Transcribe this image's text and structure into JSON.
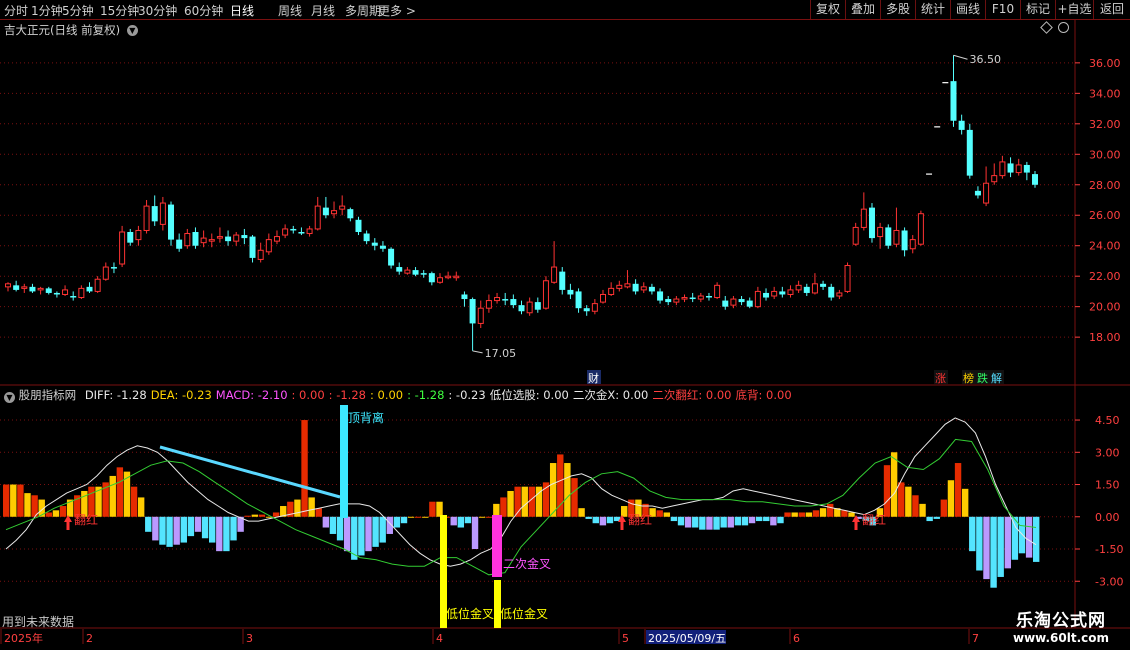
{
  "toolbar": {
    "periods": [
      "分时",
      "1分钟",
      "5分钟",
      "15分钟",
      "30分钟",
      "60分钟",
      "日线",
      "周线",
      "月线",
      "多周期",
      "更多 >"
    ],
    "active_period": "日线",
    "right_buttons": [
      "复权",
      "叠加",
      "多股",
      "统计",
      "画线",
      "F10",
      "标记",
      "+自选",
      "返回"
    ]
  },
  "price_panel": {
    "title": "吉大正元(日线 前复权)",
    "high_label": "36.50",
    "low_label": "17.05",
    "cai_label": "财",
    "tags": [
      {
        "text": "涨",
        "color": "#ff3333"
      },
      {
        "text": "榜",
        "color": "#ffd200"
      },
      {
        "text": "跌",
        "color": "#33ff66"
      },
      {
        "text": "解",
        "color": "#55ddff"
      }
    ],
    "y_ticks": [
      "36.00",
      "34.00",
      "32.00",
      "30.00",
      "28.00",
      "26.00",
      "24.00",
      "22.00",
      "20.00",
      "18.00"
    ]
  },
  "indicator_panel": {
    "title": "股朋指标网",
    "values": [
      {
        "text": "DIFF: -1.28",
        "color": "#e8e8e8"
      },
      {
        "text": "DEA: -0.23",
        "color": "#ffd200"
      },
      {
        "text": "MACD: -2.10",
        "color": "#ff55ff"
      },
      {
        "text": ": 0.00",
        "color": "#ff4040"
      },
      {
        "text": ": -1.28",
        "color": "#ff4040"
      },
      {
        "text": ": 0.00",
        "color": "#ffd200"
      },
      {
        "text": ": -1.28",
        "color": "#40ff40"
      },
      {
        "text": ": -0.23",
        "color": "#e8e8e8"
      },
      {
        "text": "低位选股: 0.00",
        "color": "#e8e8e8"
      },
      {
        "text": "二次金X: 0.00",
        "color": "#e8e8e8"
      },
      {
        "text": "二次翻红: 0.00",
        "color": "#ff4040"
      },
      {
        "text": "底背: 0.00",
        "color": "#ff4040"
      }
    ],
    "y_ticks": [
      "4.50",
      "3.00",
      "1.50",
      "0.00",
      "-1.50",
      "-3.00"
    ],
    "annotations": {
      "top_divergence": "顶背离",
      "low_gold_1": "低位金叉",
      "low_gold_2": "低位金叉",
      "second_gold": "二次金叉",
      "flip_red": "翻红"
    },
    "footer_note": "用到未来数据"
  },
  "date_axis": {
    "labels": [
      "2025年",
      "2",
      "3",
      "4",
      "5",
      "2025/05/09/五",
      "6",
      "7"
    ]
  },
  "watermark": {
    "name": "乐淘公式网",
    "url": "www.60lt.com"
  },
  "colors": {
    "up": "#ff3333",
    "down": "#54ffff",
    "grid": "#7a1010",
    "axis_text": "#ff4040",
    "bar_red": "#e62b00",
    "bar_yellow": "#ffcc00",
    "bar_cyan": "#54e5ff",
    "bar_violet": "#bb99ff"
  },
  "chart_data": [
    {
      "type": "candlestick",
      "title": "吉大正元(日线 前复权)",
      "ylim": [
        16.5,
        37.5
      ],
      "candles": [
        [
          21.3,
          21.5,
          21.6,
          21.0
        ],
        [
          21.4,
          21.1,
          21.7,
          21.0
        ],
        [
          21.2,
          21.3,
          21.5,
          20.9
        ],
        [
          21.3,
          21.0,
          21.5,
          20.9
        ],
        [
          21.1,
          21.2,
          21.3,
          20.8
        ],
        [
          21.2,
          20.9,
          21.3,
          20.8
        ],
        [
          20.9,
          20.8,
          21.0,
          20.6
        ],
        [
          20.8,
          21.1,
          21.4,
          20.7
        ],
        [
          20.7,
          20.6,
          21.0,
          20.4
        ],
        [
          20.6,
          21.2,
          21.4,
          20.5
        ],
        [
          21.3,
          21.0,
          21.6,
          20.9
        ],
        [
          21.0,
          21.8,
          22.0,
          20.9
        ],
        [
          21.8,
          22.6,
          22.9,
          21.7
        ],
        [
          22.6,
          22.5,
          22.9,
          22.2
        ],
        [
          22.8,
          24.9,
          25.3,
          22.6
        ],
        [
          24.9,
          24.2,
          25.1,
          24.0
        ],
        [
          24.4,
          25.0,
          25.3,
          24.0
        ],
        [
          25.0,
          26.6,
          27.0,
          24.8
        ],
        [
          26.6,
          25.6,
          27.3,
          25.3
        ],
        [
          25.4,
          26.8,
          27.2,
          25.0
        ],
        [
          26.7,
          24.4,
          26.9,
          24.0
        ],
        [
          24.4,
          23.8,
          24.8,
          23.6
        ],
        [
          24.0,
          24.8,
          25.1,
          23.8
        ],
        [
          24.9,
          24.0,
          25.2,
          23.8
        ],
        [
          24.2,
          24.5,
          25.0,
          23.9
        ],
        [
          24.3,
          24.4,
          24.8,
          23.9
        ],
        [
          24.5,
          24.6,
          25.2,
          24.2
        ],
        [
          24.6,
          24.3,
          25.0,
          24.0
        ],
        [
          24.3,
          24.7,
          24.9,
          24.0
        ],
        [
          24.7,
          24.5,
          25.1,
          24.1
        ],
        [
          24.6,
          23.2,
          24.7,
          22.9
        ],
        [
          23.1,
          23.7,
          24.2,
          22.9
        ],
        [
          23.6,
          24.4,
          24.8,
          23.4
        ],
        [
          24.3,
          24.6,
          25.0,
          24.1
        ],
        [
          24.7,
          25.1,
          25.4,
          24.5
        ],
        [
          25.1,
          25.0,
          25.3,
          24.8
        ],
        [
          24.9,
          24.8,
          25.2,
          24.7
        ],
        [
          24.8,
          25.1,
          25.3,
          24.6
        ],
        [
          25.1,
          26.6,
          27.2,
          25.0
        ],
        [
          26.5,
          26.0,
          27.2,
          25.8
        ],
        [
          26.1,
          26.3,
          26.9,
          25.8
        ],
        [
          26.4,
          26.6,
          27.3,
          26.0
        ],
        [
          26.4,
          25.8,
          26.5,
          25.6
        ],
        [
          25.7,
          24.9,
          25.9,
          24.7
        ],
        [
          24.8,
          24.3,
          25.0,
          24.1
        ],
        [
          24.2,
          24.0,
          24.5,
          23.7
        ],
        [
          24.0,
          23.8,
          24.3,
          23.6
        ],
        [
          23.8,
          22.7,
          23.9,
          22.5
        ],
        [
          22.6,
          22.3,
          22.9,
          22.1
        ],
        [
          22.2,
          22.4,
          22.6,
          22.1
        ],
        [
          22.4,
          22.1,
          22.6,
          22.0
        ],
        [
          22.2,
          22.1,
          22.4,
          21.9
        ],
        [
          22.2,
          21.6,
          22.3,
          21.4
        ],
        [
          21.6,
          21.9,
          22.2,
          21.5
        ],
        [
          21.9,
          22.0,
          22.3,
          21.8
        ],
        [
          21.9,
          22.0,
          22.3,
          21.7
        ],
        [
          20.8,
          20.5,
          21.0,
          20.0
        ],
        [
          20.5,
          18.9,
          20.6,
          17.1
        ],
        [
          18.9,
          19.9,
          20.4,
          18.6
        ],
        [
          19.9,
          20.4,
          20.8,
          19.6
        ],
        [
          20.4,
          20.6,
          20.9,
          20.2
        ],
        [
          20.5,
          20.4,
          20.9,
          20.1
        ],
        [
          20.5,
          20.1,
          20.8,
          19.9
        ],
        [
          20.1,
          19.7,
          20.4,
          19.5
        ],
        [
          19.6,
          20.3,
          20.6,
          19.4
        ],
        [
          20.3,
          19.8,
          20.6,
          19.6
        ],
        [
          19.9,
          21.7,
          22.0,
          19.8
        ],
        [
          21.6,
          22.6,
          24.3,
          21.5
        ],
        [
          22.3,
          21.1,
          22.6,
          20.8
        ],
        [
          21.1,
          20.8,
          21.5,
          20.5
        ],
        [
          21.0,
          19.9,
          21.2,
          19.6
        ],
        [
          19.9,
          19.7,
          20.1,
          19.4
        ],
        [
          19.7,
          20.2,
          20.5,
          19.5
        ],
        [
          20.3,
          20.8,
          21.1,
          20.2
        ],
        [
          20.8,
          21.2,
          21.6,
          20.7
        ],
        [
          21.2,
          21.4,
          21.7,
          21.0
        ],
        [
          21.3,
          21.5,
          22.4,
          21.2
        ],
        [
          21.5,
          21.0,
          21.8,
          20.8
        ],
        [
          21.1,
          21.3,
          21.6,
          20.9
        ],
        [
          21.3,
          21.0,
          21.5,
          20.8
        ],
        [
          21.0,
          20.4,
          21.2,
          20.2
        ],
        [
          20.5,
          20.3,
          20.7,
          20.1
        ],
        [
          20.3,
          20.5,
          20.7,
          20.1
        ],
        [
          20.5,
          20.6,
          20.8,
          20.3
        ],
        [
          20.6,
          20.5,
          20.9,
          20.3
        ],
        [
          20.5,
          20.7,
          20.9,
          20.3
        ],
        [
          20.7,
          20.6,
          20.9,
          20.4
        ],
        [
          20.6,
          21.4,
          21.6,
          20.5
        ],
        [
          20.4,
          20.0,
          20.7,
          19.8
        ],
        [
          20.1,
          20.5,
          20.7,
          19.9
        ],
        [
          20.5,
          20.3,
          20.7,
          20.1
        ],
        [
          20.4,
          20.0,
          20.6,
          19.9
        ],
        [
          20.0,
          21.0,
          21.3,
          19.9
        ],
        [
          20.9,
          20.6,
          21.2,
          20.4
        ],
        [
          20.7,
          21.0,
          21.3,
          20.5
        ],
        [
          21.0,
          20.8,
          21.3,
          20.6
        ],
        [
          20.8,
          21.1,
          21.4,
          20.6
        ],
        [
          21.1,
          21.4,
          21.7,
          20.9
        ],
        [
          21.3,
          20.9,
          21.5,
          20.7
        ],
        [
          20.9,
          21.5,
          22.2,
          20.8
        ],
        [
          21.5,
          21.3,
          21.7,
          21.1
        ],
        [
          21.3,
          20.6,
          21.5,
          20.4
        ],
        [
          20.7,
          20.9,
          21.1,
          20.5
        ],
        [
          21.0,
          22.7,
          22.9,
          20.9
        ],
        [
          24.1,
          25.2,
          25.5,
          24.0
        ],
        [
          25.2,
          26.4,
          27.5,
          25.0
        ],
        [
          26.5,
          24.5,
          26.8,
          24.2
        ],
        [
          24.6,
          25.2,
          25.5,
          23.8
        ],
        [
          25.2,
          24.0,
          25.4,
          23.8
        ],
        [
          24.1,
          25.0,
          26.5,
          23.9
        ],
        [
          25.0,
          23.7,
          25.2,
          23.3
        ],
        [
          23.8,
          24.4,
          24.7,
          23.5
        ],
        [
          24.1,
          26.1,
          26.3,
          24.0
        ],
        [
          28.7,
          28.7,
          28.7,
          28.7
        ],
        [
          31.8,
          31.8,
          31.8,
          31.8
        ],
        [
          34.7,
          34.7,
          34.7,
          34.7
        ],
        [
          34.8,
          32.2,
          36.5,
          31.8
        ],
        [
          32.2,
          31.6,
          32.6,
          31.3
        ],
        [
          31.6,
          28.6,
          32.0,
          28.4
        ],
        [
          27.6,
          27.3,
          27.9,
          27.1
        ],
        [
          26.8,
          28.1,
          29.2,
          26.6
        ],
        [
          28.2,
          28.6,
          29.4,
          28.0
        ],
        [
          28.6,
          29.5,
          29.9,
          28.4
        ],
        [
          29.4,
          28.8,
          29.8,
          28.5
        ],
        [
          28.8,
          29.3,
          29.7,
          28.6
        ],
        [
          29.3,
          28.8,
          29.5,
          28.3
        ],
        [
          28.7,
          28.0,
          28.9,
          27.8
        ]
      ]
    },
    {
      "type": "bar",
      "title": "股朋指标网",
      "ylim": [
        -3.5,
        5.2
      ],
      "values": [
        1.5,
        1.5,
        1.5,
        1.1,
        1.0,
        0.8,
        0.2,
        0.3,
        0.5,
        0.8,
        1.0,
        1.2,
        1.4,
        1.4,
        1.6,
        1.9,
        2.3,
        2.1,
        1.4,
        0.9,
        -0.7,
        -1.1,
        -1.3,
        -1.4,
        -1.3,
        -1.2,
        -0.9,
        -0.7,
        -1.0,
        -1.2,
        -1.6,
        -1.6,
        -1.1,
        -0.7,
        0.05,
        0.1,
        0.1,
        0.0,
        0.2,
        0.5,
        0.7,
        0.8,
        4.5,
        0.9,
        0.4,
        -0.5,
        -0.8,
        -1.1,
        -1.6,
        -2.0,
        -1.8,
        -1.6,
        -1.4,
        -1.2,
        -0.8,
        -0.5,
        -0.3,
        0.0,
        0.0,
        0.0,
        0.7,
        0.7,
        0.0,
        -0.4,
        -0.5,
        -0.3,
        -1.5,
        0.0,
        0.0,
        0.6,
        0.9,
        1.2,
        1.4,
        1.4,
        1.4,
        1.4,
        1.6,
        2.5,
        2.9,
        2.5,
        1.8,
        0.4,
        -0.1,
        -0.3,
        -0.4,
        -0.3,
        -0.2,
        0.5,
        0.8,
        0.8,
        0.6,
        0.4,
        0.3,
        0.2,
        -0.2,
        -0.4,
        -0.5,
        -0.5,
        -0.6,
        -0.6,
        -0.6,
        -0.5,
        -0.5,
        -0.4,
        -0.4,
        -0.3,
        -0.2,
        -0.2,
        -0.4,
        -0.3,
        0.2,
        0.2,
        0.2,
        0.2,
        0.3,
        0.4,
        0.6,
        0.4,
        0.3,
        0.2,
        -0.1,
        -0.2,
        -0.4,
        0.4,
        2.4,
        3.0,
        1.6,
        1.4,
        1.0,
        0.6,
        -0.2,
        -0.1,
        0.8,
        1.7,
        2.5,
        1.3,
        -1.6,
        -2.5,
        -2.9,
        -3.3,
        -2.8,
        -2.4,
        -2.0,
        -1.7,
        -1.9,
        -2.1
      ],
      "diff": [
        -1.5,
        -1.1,
        -0.6,
        0.1,
        0.5,
        0.8,
        1.1,
        1.3,
        1.5,
        1.9,
        2.4,
        2.8,
        3.1,
        3.3,
        3.2,
        3.0,
        2.6,
        2.1,
        1.6,
        1.2,
        0.8,
        0.5,
        0.2,
        0.0,
        -0.2,
        -0.2,
        -0.1,
        0.0,
        0.1,
        0.2,
        0.3,
        0.4,
        0.5,
        0.6,
        0.6,
        0.6,
        0.5,
        0.2,
        -0.3,
        -0.8,
        -1.3,
        -1.7,
        -2.0,
        -2.2,
        -2.3,
        -2.2,
        -2.0,
        -1.7,
        -1.5,
        -1.0,
        -0.2,
        0.4,
        0.8,
        1.2,
        1.5,
        1.7,
        1.9,
        2.0,
        1.8,
        1.3,
        1.0,
        0.8,
        0.6,
        0.5,
        0.5,
        0.4,
        0.5,
        0.6,
        0.7,
        0.8,
        0.8,
        0.9,
        1.2,
        1.3,
        1.2,
        1.1,
        1.0,
        0.9,
        0.8,
        0.7,
        0.6,
        0.5,
        0.4,
        0.3,
        0.2,
        0.1,
        0.3,
        0.6,
        1.1,
        2.0,
        2.8,
        3.3,
        3.8,
        4.3,
        4.6,
        4.4,
        3.9,
        2.8,
        1.5,
        0.5,
        -0.5,
        -1.0,
        -1.3
      ],
      "dea": [
        -0.6,
        -0.3,
        0.0,
        0.4,
        0.7,
        1.0,
        1.3,
        1.6,
        2.0,
        2.4,
        2.6,
        2.5,
        2.1,
        1.6,
        1.1,
        0.6,
        0.2,
        -0.2,
        -0.6,
        -0.9,
        -1.2,
        -1.5,
        -1.9,
        -2.0,
        -2.2,
        -2.3,
        -2.3,
        -1.9,
        -1.9,
        -2.3,
        -2.7,
        -2.6,
        -1.4,
        -0.6,
        0.2,
        1.0,
        1.6,
        2.0,
        2.1,
        1.8,
        1.2,
        0.9,
        0.8,
        0.8,
        0.8,
        0.8,
        0.7,
        0.7,
        0.6,
        0.5,
        0.5,
        0.6,
        1.0,
        1.8,
        2.5,
        2.8,
        2.3,
        2.2,
        2.7,
        3.6,
        3.5,
        2.2,
        0.5,
        -0.4,
        -0.5
      ]
    }
  ]
}
